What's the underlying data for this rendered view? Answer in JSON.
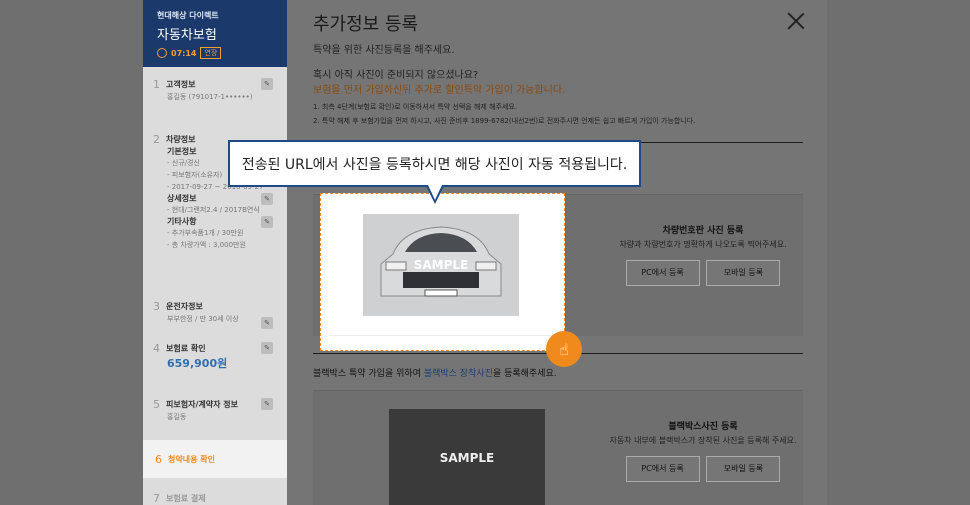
{
  "sidebar": {
    "brand": "현대해상 다이렉트",
    "product": "자동차보험",
    "timer": "07:14",
    "extend": "연장",
    "sections": [
      {
        "num": "1",
        "title": "고객정보",
        "lines": [
          "홍길동 (791017-1••••••)"
        ]
      },
      {
        "num": "2",
        "title": "차량정보",
        "basic": "기본정보",
        "basic_lines": [
          "- 신규/경신",
          "- 피보험자(소유자)",
          "- 2017-09-27 ~ 2018-09-27"
        ],
        "detail": "상세정보",
        "detail_lines": [
          "- 현대/그랜저2.4 / 2017B연식"
        ],
        "etc": "기타사항",
        "etc_lines": [
          "- 추가부속품1개 / 30만원",
          "- 총 차량가액 : 3,000만원"
        ]
      },
      {
        "num": "3",
        "title": "운전자정보",
        "lines": [
          "부부한정 / 만 30세 이상"
        ]
      },
      {
        "num": "4",
        "title": "보험료 확인",
        "value": "659,900원"
      },
      {
        "num": "5",
        "title": "피보험자/계약자 정보",
        "lines": [
          "홍길동"
        ]
      },
      {
        "num": "6",
        "title": "청약내용 확인"
      },
      {
        "num": "7",
        "title": "보험료 결제"
      }
    ]
  },
  "modal": {
    "title": "추가정보 등록",
    "subtitle": "특약을 위한 사진등록을 해주세요.",
    "q": "혹시 아직 사진이 준비되지 않으셨나요?",
    "q_orange": "보험을 먼저 가입하신뒤 추가로 할인특약 가입이 가능합니다.",
    "note1": "1. 최측 4단계(보험료 확인)로 이동하셔서 특약 선택을 해제 해주세요.",
    "note2": "2. 특약 해제 후 보험가입을 먼저 하시고, 사진 준비후 1899-6782(내선2번)로 전화주시면 언제든 쉽고 빠르게 가입이 가능합니다.",
    "tooltip": "전송된 URL에서 사진을 등록하시면 해당 사진이 자동 적용됩니다.",
    "plate_title": "차량번호판 사진 등록",
    "plate_desc": "차량과 차량번호가 명확하게 나오도록 찍어주세요.",
    "pc_btn": "PC에서 등록",
    "mobile_btn": "모바일 등록",
    "sample": "SAMPLE",
    "bb_prefix": "블랙박스 특약 가입을 위하여 ",
    "bb_link": "블랙박스 장착사진",
    "bb_suffix": "을 등록해주세요.",
    "bb_title": "블랙박스사진 등록",
    "bb_desc": "자동차 내부에 블랙박스가 장착된 사진을 등록해 주세요."
  }
}
